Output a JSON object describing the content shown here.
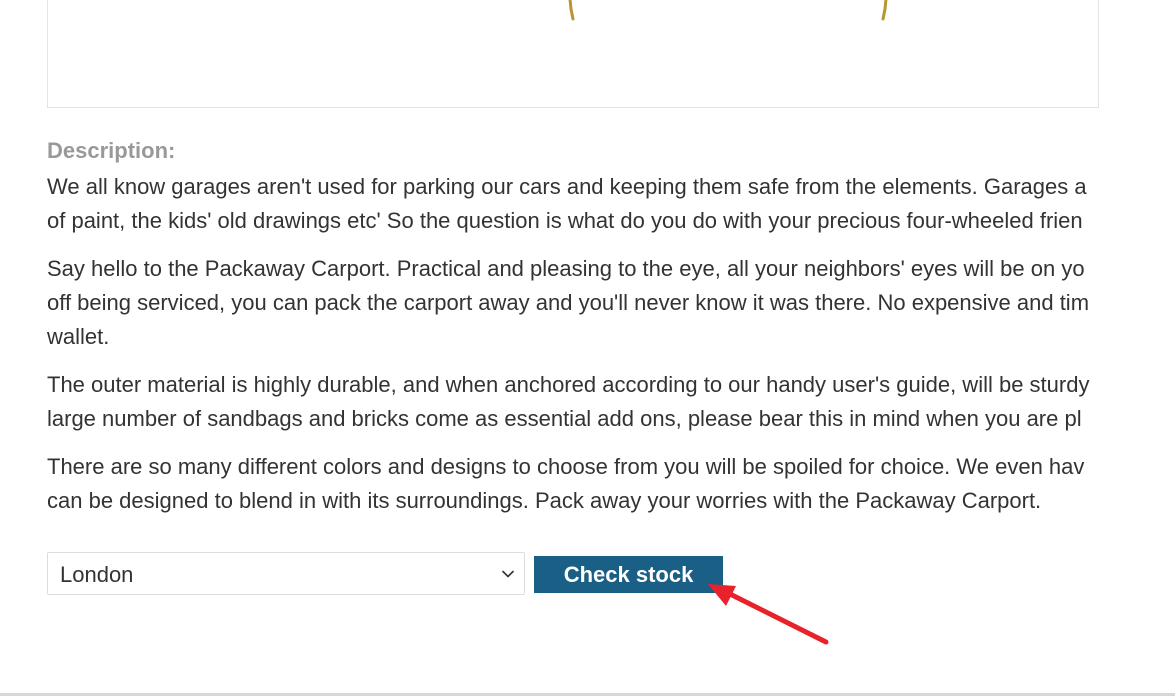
{
  "product": {
    "description_label": "Description:",
    "paragraphs": [
      {
        "lines": [
          "We all know garages aren't used for parking our cars and keeping them safe from the elements. Garages a",
          "of paint, the kids' old drawings etc' So the question is what do you do with your precious four-wheeled frien"
        ]
      },
      {
        "lines": [
          "Say hello to the Packaway Carport. Practical and pleasing to the eye, all your neighbors' eyes will be on yo",
          "off being serviced, you can pack the carport away and you'll never know it was there. No expensive and tim",
          "wallet."
        ]
      },
      {
        "lines": [
          "The outer material is highly durable, and when anchored according to our handy user's guide, will be sturdy",
          "large number of sandbags and bricks come as essential add ons, please bear this in mind when you are pl"
        ]
      },
      {
        "lines": [
          "There are so many different colors and designs to choose from you will be spoiled for choice. We even hav",
          "can be designed to blend in with its surroundings. Pack away your worries with the Packaway Carport."
        ]
      }
    ]
  },
  "stock_check": {
    "location_selected": "London",
    "button_label": "Check stock"
  },
  "icons": {
    "dropdown": "chevron-down-icon",
    "annotation": "red-arrow-annotation"
  },
  "colors": {
    "button_bg": "#1a5f85",
    "label_gray": "#999999",
    "annotation_red": "#e8212b"
  }
}
